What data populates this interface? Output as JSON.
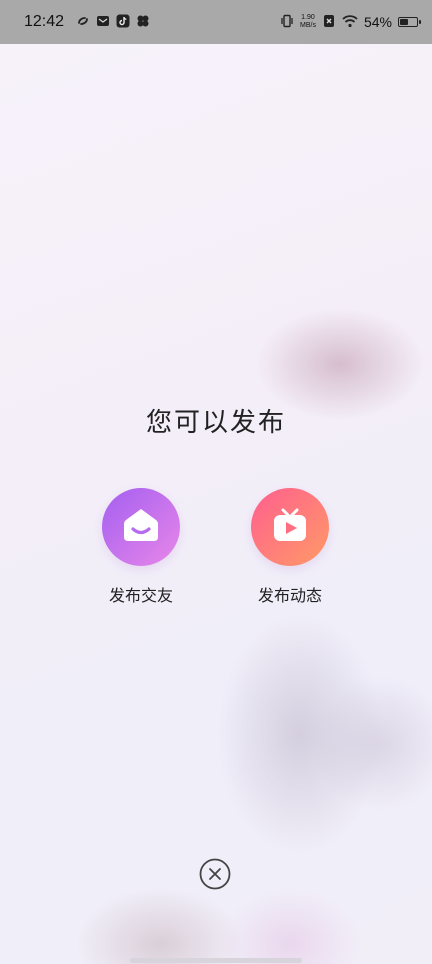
{
  "status_bar": {
    "time": "12:42",
    "net_speed_value": "1.90",
    "net_speed_unit": "MB/s",
    "battery_percent": "54%",
    "battery_level": 0.54,
    "icons": [
      "sync-icon",
      "mail-icon",
      "tiktok-icon",
      "clover-icon",
      "vibrate-icon",
      "no-sim-icon",
      "wifi-icon",
      "battery-icon"
    ]
  },
  "main": {
    "title": "您可以发布",
    "actions": [
      {
        "label": "发布交友",
        "icon": "home-smile-icon",
        "gradient": [
          "#a35ff0",
          "#e987e9"
        ]
      },
      {
        "label": "发布动态",
        "icon": "tv-play-icon",
        "gradient": [
          "#ff5f8f",
          "#ff9a66"
        ]
      }
    ]
  },
  "colors": {
    "status_bar_bg": "#a9a9a9",
    "text_primary": "#222222",
    "close_icon": "#444444"
  }
}
